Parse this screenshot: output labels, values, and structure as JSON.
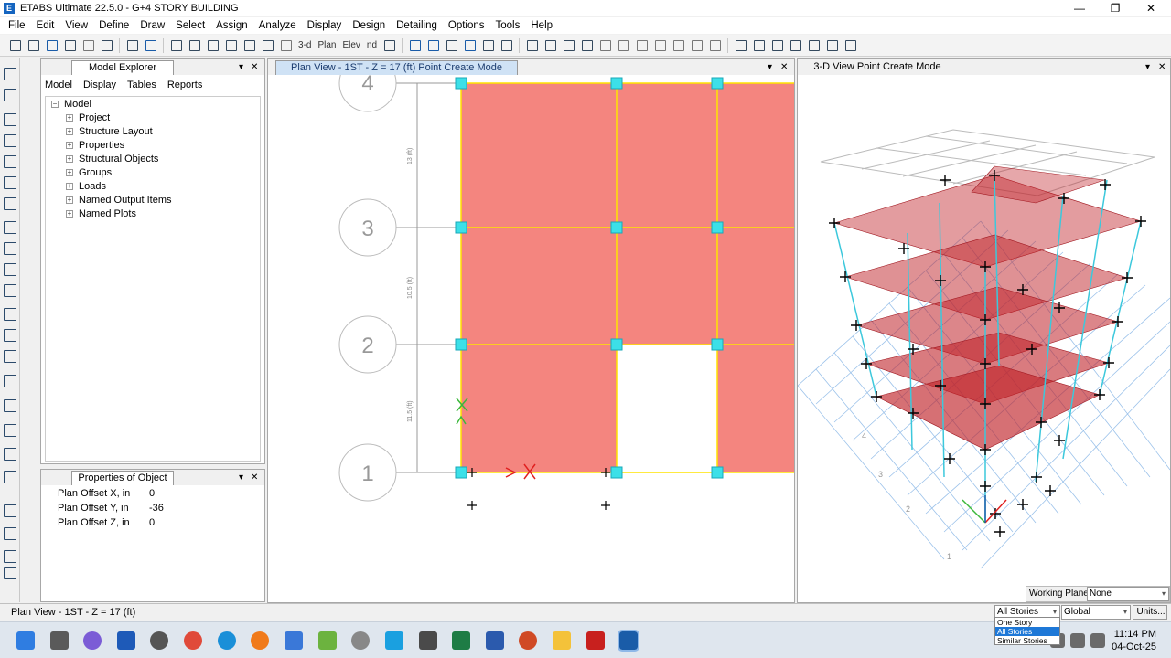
{
  "window": {
    "title": "ETABS Ultimate 22.5.0 - G+4 STORY BUILDING",
    "app_icon_letter": "E",
    "minimize": "—",
    "maximize": "❐",
    "close": "✕"
  },
  "menu": [
    "File",
    "Edit",
    "View",
    "Define",
    "Draw",
    "Select",
    "Assign",
    "Analyze",
    "Display",
    "Design",
    "Detailing",
    "Options",
    "Tools",
    "Help"
  ],
  "toolbar": {
    "view_3d_label": "3-d",
    "plan_label": "Plan",
    "elev_label": "Elev",
    "nd_label": "nd"
  },
  "model_explorer": {
    "title": "Model Explorer",
    "tabs": [
      "Model",
      "Display",
      "Tables",
      "Reports"
    ],
    "tree_root": "Model",
    "tree_items": [
      "Project",
      "Structure Layout",
      "Properties",
      "Structural Objects",
      "Groups",
      "Loads",
      "Named Output Items",
      "Named Plots"
    ]
  },
  "properties": {
    "title": "Properties of Object",
    "rows": [
      {
        "label": "Plan Offset X, in",
        "value": "0"
      },
      {
        "label": "Plan Offset Y, in",
        "value": "-36"
      },
      {
        "label": "Plan Offset Z, in",
        "value": "0"
      }
    ]
  },
  "plan_view": {
    "title": "Plan View - 1ST - Z = 17 (ft)  Point Create Mode",
    "grid_bubbles": [
      "4",
      "3",
      "2",
      "1"
    ],
    "dims": [
      "13 (ft)",
      "10.5 (ft)",
      "11.5 (ft)"
    ]
  },
  "view_3d": {
    "title": "3-D View  Point Create Mode",
    "base_grid_labels": [
      "4",
      "3",
      "2",
      "1"
    ]
  },
  "status": {
    "text": "Plan View - 1ST - Z = 17 (ft)",
    "working_plane_label": "Working Plane",
    "working_plane_value": "None",
    "stories_value": "All Stories",
    "stories_options": [
      "One Story",
      "All Stories",
      "Similar Stories"
    ],
    "coord_value": "Global",
    "units_label": "Units..."
  },
  "taskbar": {
    "time": "11:14 PM",
    "date": "04-Oct-25"
  },
  "colors": {
    "slab": "#f4857f",
    "slab_3d": "#c0232a",
    "column_3d": "#3cc8dc",
    "grid_line": "#ffe400",
    "accent": "#1a5ca8"
  }
}
